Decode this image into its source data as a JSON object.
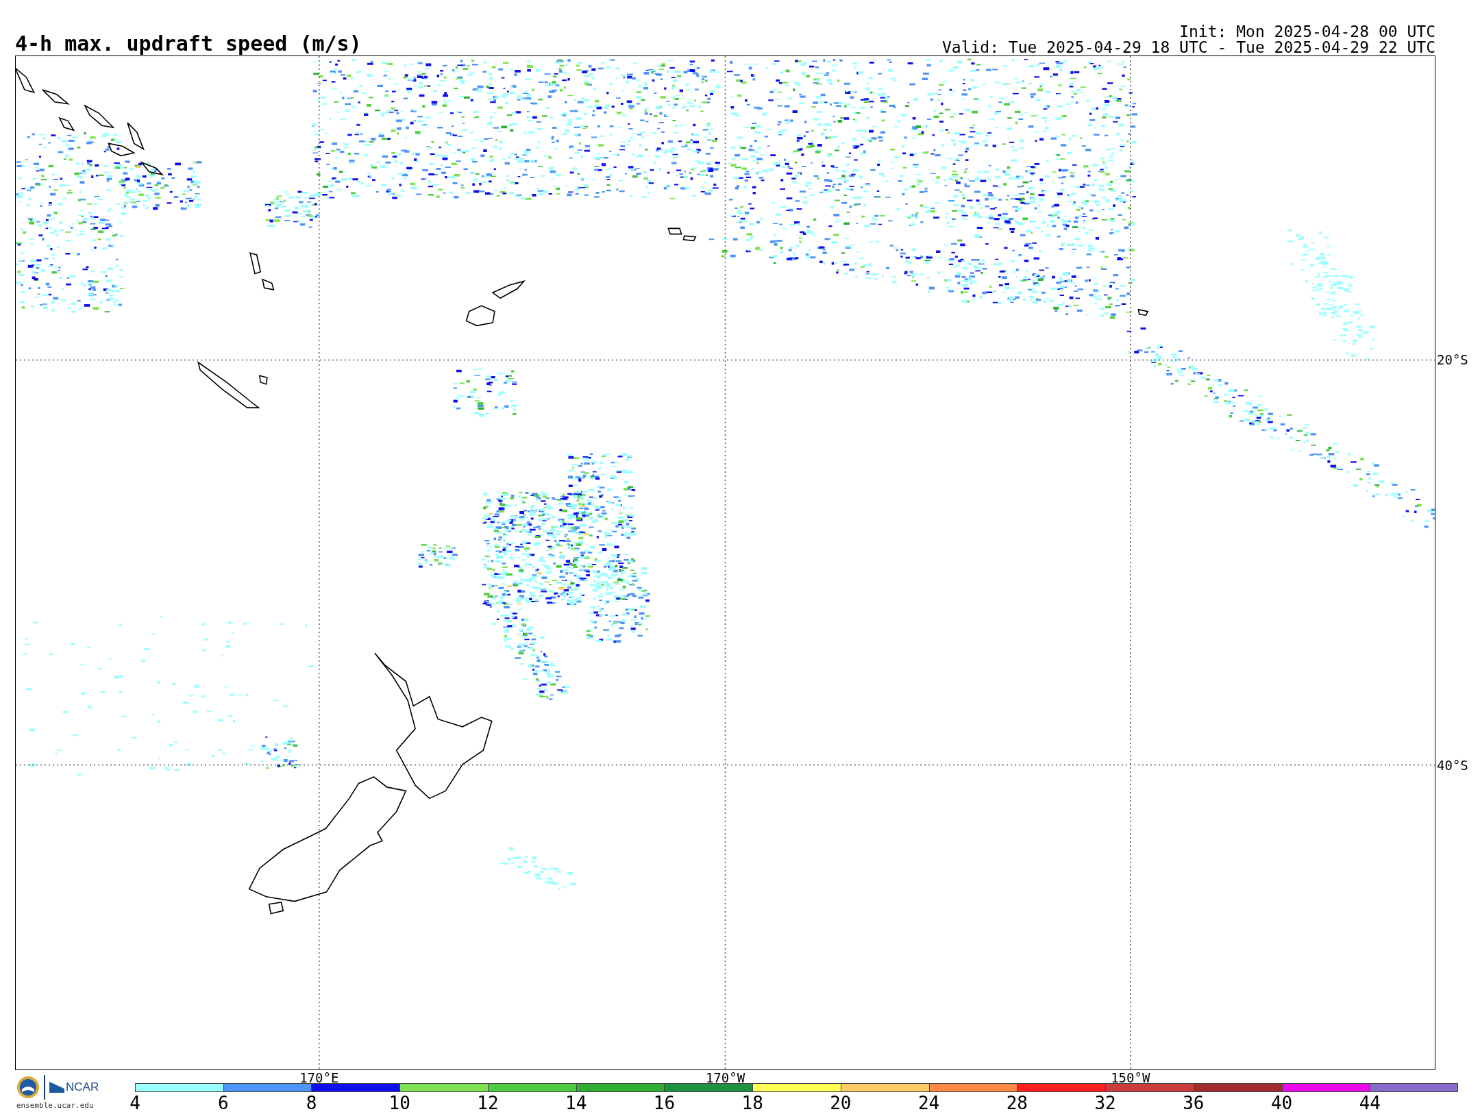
{
  "title": "4-h max. updraft speed (m/s)",
  "init": "Init: Mon 2025-04-28 00 UTC",
  "valid": "Valid: Tue 2025-04-29 18 UTC - Tue 2025-04-29 22 UTC",
  "map": {
    "longitude_labels": [
      "170°E",
      "170°W",
      "150°W"
    ],
    "latitude_labels": [
      "20°S",
      "40°S"
    ]
  },
  "logos": {
    "org": "NCAR",
    "site": "ensemble.ucar.edu"
  },
  "colorbar": {
    "bins": [
      {
        "label": "4",
        "color": "#99ffff"
      },
      {
        "label": "6",
        "color": "#4d96f7"
      },
      {
        "label": "8",
        "color": "#0e0eef"
      },
      {
        "label": "10",
        "color": "#7ee252"
      },
      {
        "label": "12",
        "color": "#4fcb3f"
      },
      {
        "label": "14",
        "color": "#2fae33"
      },
      {
        "label": "16",
        "color": "#1e9240"
      },
      {
        "label": "18",
        "color": "#ffff57"
      },
      {
        "label": "20",
        "color": "#fecb64"
      },
      {
        "label": "24",
        "color": "#fe8947"
      },
      {
        "label": "28",
        "color": "#fe1f1f"
      },
      {
        "label": "32",
        "color": "#cc3c3c"
      },
      {
        "label": "36",
        "color": "#a32c2c"
      },
      {
        "label": "40",
        "color": "#ee0aee"
      },
      {
        "label": "44",
        "color": "#8b6acd"
      }
    ]
  }
}
